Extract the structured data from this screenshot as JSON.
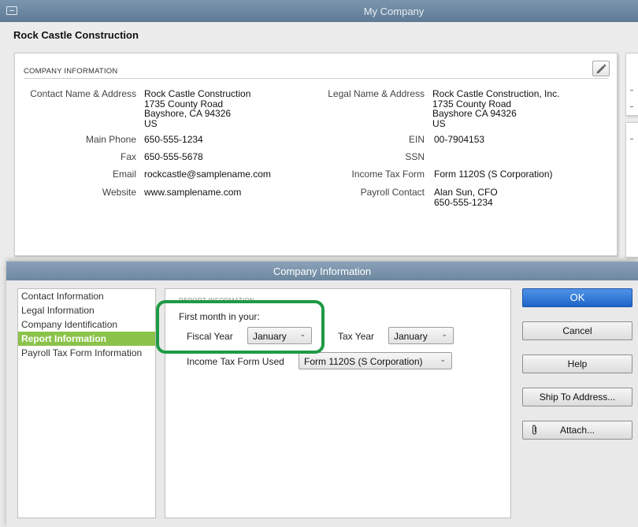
{
  "window": {
    "title": "My Company"
  },
  "company": {
    "name": "Rock Castle Construction"
  },
  "company_info": {
    "section_label": "COMPANY INFORMATION",
    "edit_icon": "pencil-icon",
    "left": [
      {
        "label": "Contact Name & Address",
        "lines": [
          "Rock Castle Construction",
          "1735 County Road",
          "Bayshore, CA 94326",
          "US"
        ]
      },
      {
        "label": "Main Phone",
        "lines": [
          "650-555-1234"
        ]
      },
      {
        "label": "Fax",
        "lines": [
          "650-555-5678"
        ]
      },
      {
        "label": "Email",
        "lines": [
          "rockcastle@samplename.com"
        ]
      },
      {
        "label": "Website",
        "lines": [
          "www.samplename.com"
        ]
      }
    ],
    "right": [
      {
        "label": "Legal Name & Address",
        "lines": [
          "Rock Castle Construction, Inc.",
          "1735 County Road",
          "Bayshore CA 94326",
          "US"
        ]
      },
      {
        "label": "EIN",
        "lines": [
          "00-7904153"
        ]
      },
      {
        "label": "SSN",
        "lines": [
          ""
        ]
      },
      {
        "label": "Income Tax Form",
        "lines": [
          "Form 1120S (S Corporation)"
        ]
      },
      {
        "label": "Payroll Contact",
        "lines": [
          "Alan Sun, CFO",
          "650-555-1234"
        ]
      }
    ]
  },
  "dialog": {
    "title": "Company Information",
    "nav": [
      {
        "label": "Contact Information",
        "active": false
      },
      {
        "label": "Legal Information",
        "active": false
      },
      {
        "label": "Company Identification",
        "active": false
      },
      {
        "label": "Report Information",
        "active": true
      },
      {
        "label": "Payroll Tax Form Information",
        "active": false
      }
    ],
    "panel": {
      "section_label": "REPORT INFORMATION",
      "first_month_label": "First month in your:",
      "fiscal_year_label": "Fiscal Year",
      "fiscal_year_value": "January",
      "tax_year_label": "Tax Year",
      "tax_year_value": "January",
      "income_tax_form_label": "Income Tax Form Used",
      "income_tax_form_value": "Form 1120S (S Corporation)"
    },
    "buttons": {
      "ok": "OK",
      "cancel": "Cancel",
      "help": "Help",
      "ship_to": "Ship To Address...",
      "attach": "Attach..."
    }
  },
  "colors": {
    "highlight": "#1e9a46",
    "nav_active": "#8bc34a",
    "primary_button": "#2a73d6",
    "titlebar": "#6f89a2"
  }
}
